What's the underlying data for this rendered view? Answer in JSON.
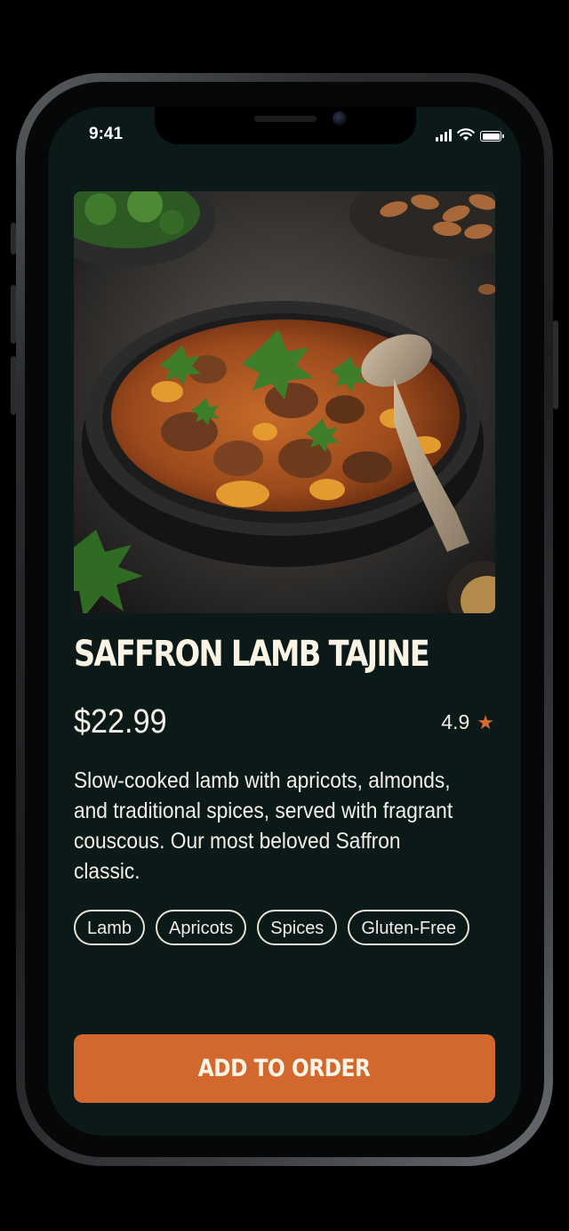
{
  "status_bar": {
    "time": "9:41"
  },
  "dish": {
    "name": "SAFFRON LAMB TAJINE",
    "price": "$22.99",
    "rating": "4.9",
    "description": "Slow-cooked lamb with apricots, almonds, and traditional spices, served with fragrant couscous. Our most beloved Saffron classic.",
    "tags": [
      "Lamb",
      "Apricots",
      "Spices",
      "Gluten-Free"
    ]
  },
  "actions": {
    "add_to_order_label": "ADD TO ORDER"
  },
  "colors": {
    "background": "#0c1919",
    "accent": "#d3682f",
    "star": "#d86a32",
    "text": "#f2efe7"
  },
  "icons": [
    "signal-icon",
    "wifi-icon",
    "battery-icon",
    "star-icon"
  ]
}
